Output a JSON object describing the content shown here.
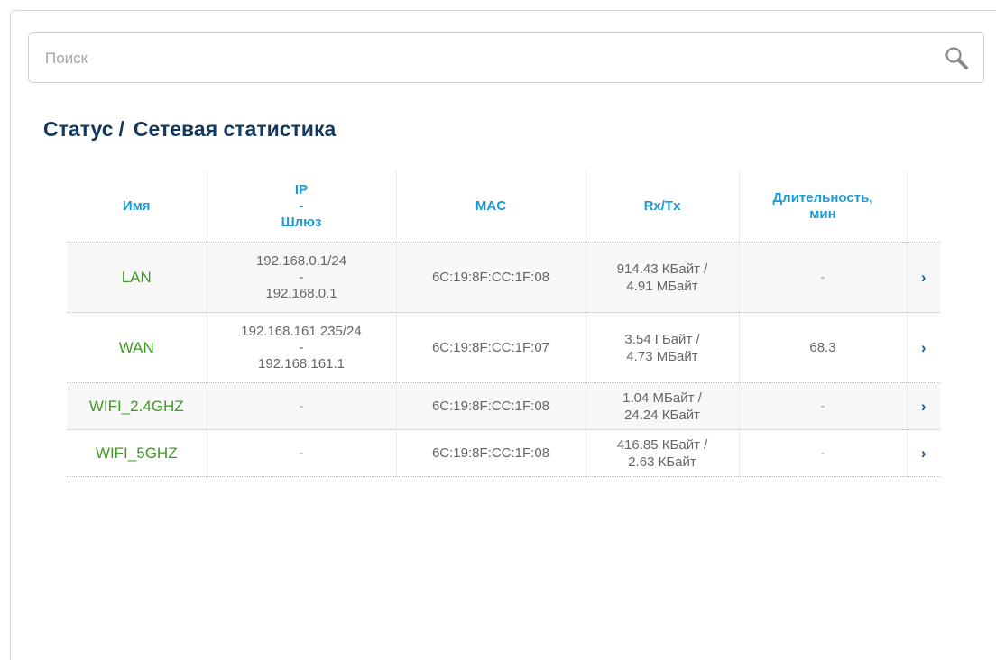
{
  "search": {
    "placeholder": "Поиск",
    "value": ""
  },
  "breadcrumb": {
    "section": "Статус",
    "separator": "/",
    "page": "Сетевая статистика"
  },
  "table": {
    "headers": {
      "name": "Имя",
      "ip_line1": "IP",
      "ip_line2": "-",
      "ip_line3": "Шлюз",
      "mac": "MAC",
      "rxtx": "Rx/Tx",
      "duration_line1": "Длительность,",
      "duration_line2": "мин"
    },
    "rows": [
      {
        "name": "LAN",
        "ip": "192.168.0.1/24",
        "ip_sep": "-",
        "gateway": "192.168.0.1",
        "mac": "6C:19:8F:CC:1F:08",
        "rx": "914.43 КБайт /",
        "tx": "4.91 МБайт",
        "duration": "-",
        "arrow": "›"
      },
      {
        "name": "WAN",
        "ip": "192.168.161.235/24",
        "ip_sep": "-",
        "gateway": "192.168.161.1",
        "mac": "6C:19:8F:CC:1F:07",
        "rx": "3.54 ГБайт /",
        "tx": "4.73 МБайт",
        "duration": "68.3",
        "arrow": "›"
      },
      {
        "name": "WIFI_2.4GHZ",
        "ip": "-",
        "mac": "6C:19:8F:CC:1F:08",
        "rx": "1.04 МБайт /",
        "tx": "24.24 КБайт",
        "duration": "-",
        "arrow": "›"
      },
      {
        "name": "WIFI_5GHZ",
        "ip": "-",
        "mac": "6C:19:8F:CC:1F:08",
        "rx": "416.85 КБайт /",
        "tx": "2.63 КБайт",
        "duration": "-",
        "arrow": "›"
      }
    ]
  },
  "colors": {
    "title": "#13385f",
    "header": "#1a9bd7",
    "name": "#3f9a23",
    "arrow": "#1a5f9f",
    "text": "#666666"
  },
  "icons": {
    "search": "search-icon",
    "row_arrow": "chevron-right-icon"
  }
}
